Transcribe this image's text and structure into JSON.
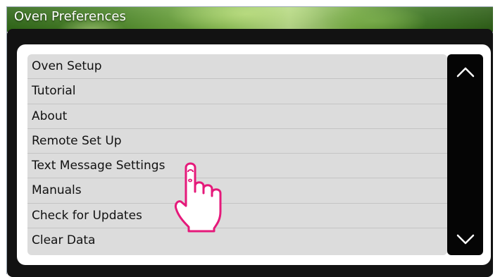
{
  "window": {
    "title": "Oven Preferences"
  },
  "menu": {
    "items": [
      {
        "label": "Oven Setup"
      },
      {
        "label": "Tutorial"
      },
      {
        "label": "About"
      },
      {
        "label": "Remote Set Up"
      },
      {
        "label": "Text Message Settings"
      },
      {
        "label": "Manuals"
      },
      {
        "label": "Check for Updates"
      },
      {
        "label": "Clear Data"
      }
    ]
  },
  "scroll": {
    "up_icon": "chevron-up-icon",
    "down_icon": "chevron-down-icon"
  },
  "pointer": {
    "icon": "tap-hand-icon",
    "target": "Text Message Settings"
  },
  "colors": {
    "list_bg": "#dcdcdc",
    "panel_dark": "#121212",
    "scrollbar": "#050505",
    "hand_accent": "#e5197a"
  }
}
